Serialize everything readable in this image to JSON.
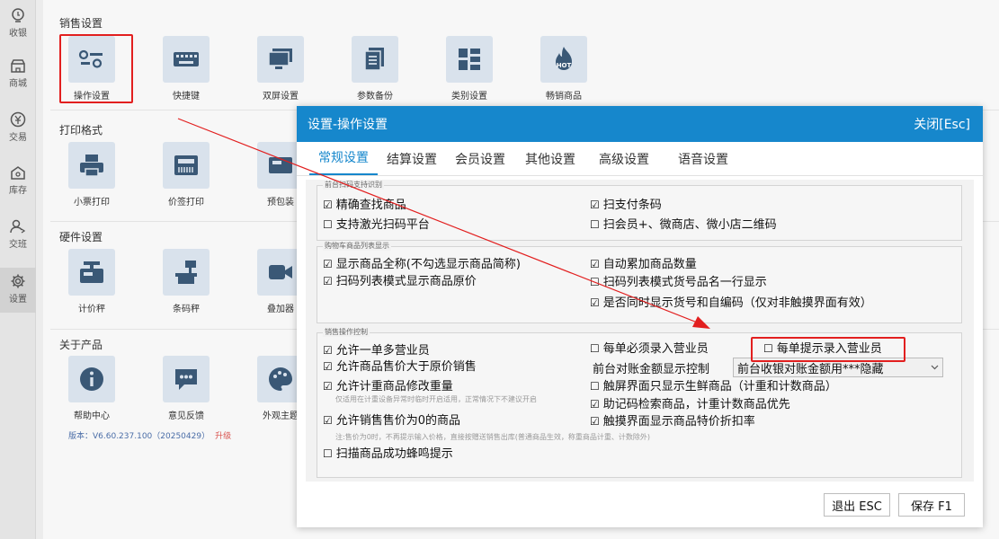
{
  "sidebar": {
    "items": [
      {
        "label": "收银",
        "icon": "cashier-icon"
      },
      {
        "label": "商城",
        "icon": "store-icon"
      },
      {
        "label": "交易",
        "icon": "yen-icon"
      },
      {
        "label": "库存",
        "icon": "warehouse-icon"
      },
      {
        "label": "交班",
        "icon": "handover-icon"
      },
      {
        "label": "设置",
        "icon": "gear-icon"
      }
    ]
  },
  "sections": {
    "sales": {
      "title": "销售设置",
      "tiles": [
        "操作设置",
        "快捷键",
        "双屏设置",
        "参数备份",
        "类别设置",
        "畅销商品"
      ]
    },
    "print": {
      "title": "打印格式",
      "tiles": [
        "小票打印",
        "价签打印",
        "预包装"
      ]
    },
    "hardware": {
      "title": "硬件设置",
      "tiles": [
        "计价秤",
        "条码秤",
        "叠加器"
      ]
    },
    "about": {
      "title": "关于产品",
      "tiles": [
        "帮助中心",
        "意见反馈",
        "外观主题"
      ]
    }
  },
  "hot_badge": "HOT",
  "version": {
    "text": "版本：V6.60.237.100（20250429）",
    "upgrade": "升级"
  },
  "dialog": {
    "title": "设置-操作设置",
    "close_label": "关闭[Esc]",
    "tabs": [
      "常规设置",
      "结算设置",
      "会员设置",
      "其他设置",
      "高级设置",
      "语音设置"
    ],
    "active_tab": 0,
    "group1": {
      "title": "前台扫码支持识别",
      "items": [
        {
          "label": "精确查找商品",
          "checked": true
        },
        {
          "label": "支持激光扫码平台",
          "checked": false
        },
        {
          "label": "扫支付条码",
          "checked": true
        },
        {
          "label": "扫会员+、微商店、微小店二维码",
          "checked": false
        }
      ]
    },
    "group2": {
      "title": "购物车商品列表显示",
      "items": [
        {
          "label": "显示商品全称(不勾选显示商品简称)",
          "checked": true
        },
        {
          "label": "扫码列表模式显示商品原价",
          "checked": true
        },
        {
          "label": "自动累加商品数量",
          "checked": true
        },
        {
          "label": "扫码列表模式货号品名一行显示",
          "checked": false
        },
        {
          "label": "是否同时显示货号和自编码（仅对非触摸界面有效）",
          "checked": true
        }
      ]
    },
    "group3": {
      "title": "销售操作控制",
      "items": [
        {
          "label": "允许一单多营业员",
          "checked": true
        },
        {
          "label": "允许商品售价大于原价销售",
          "checked": true
        },
        {
          "label": "允许计重商品修改重量",
          "checked": true
        },
        {
          "label": "允许销售售价为0的商品",
          "checked": true
        },
        {
          "label": "扫描商品成功蜂鸣提示",
          "checked": false
        },
        {
          "label": "每单必须录入营业员",
          "checked": false
        },
        {
          "label": "每单提示录入营业员",
          "checked": false
        },
        {
          "label": "触屏界面只显示生鲜商品（计重和计数商品）",
          "checked": false
        },
        {
          "label": "助记码检索商品，计重计数商品优先",
          "checked": true
        },
        {
          "label": "触摸界面显示商品特价折扣率",
          "checked": true
        }
      ],
      "note1": "仅适用在计重设备异常时临时开启适用，正常情况下不建议开启",
      "note2": "注:售价为0时，不再提示输入价格，直接按赠送销售出库(普通商品生效，称重商品计重、计数除外)",
      "amount_label": "前台对账金额显示控制",
      "amount_value": "前台收银对账金额用***隐藏"
    },
    "exit_label": "退出 ESC",
    "save_label": "保存 F1"
  },
  "colors": {
    "accent": "#1687cc",
    "highlight": "#e21f1f",
    "tile_bg": "#d9e2ec",
    "icon_dark": "#3a5876"
  }
}
